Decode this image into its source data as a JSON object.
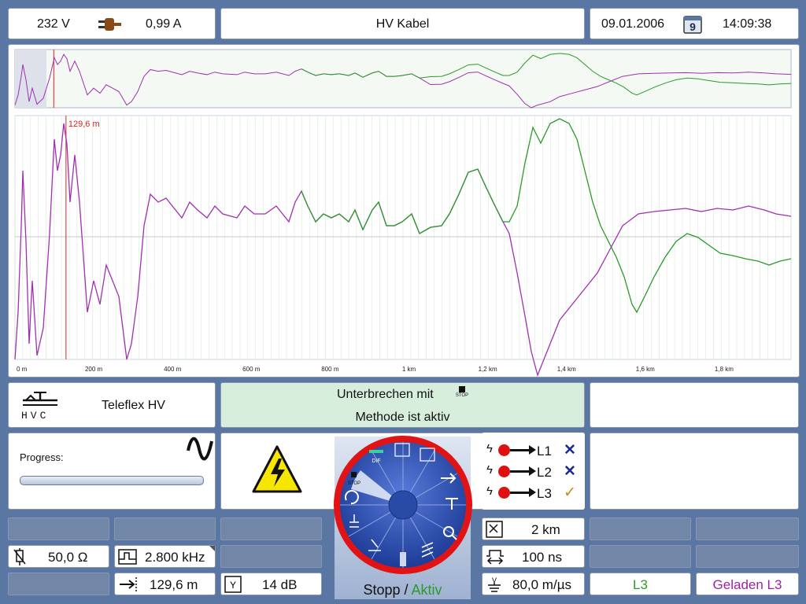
{
  "header": {
    "voltage": "232 V",
    "current": "0,99 A",
    "title": "HV Kabel",
    "date": "09.01.2006",
    "calendar_day": "9",
    "time": "14:09:38"
  },
  "plot": {
    "cursor_label": "129,6 m",
    "x_tick_labels": [
      "0 m",
      "200 m",
      "400 m",
      "600 m",
      "800 m",
      "1 km",
      "1,2 km",
      "1,4 km",
      "1,6 km",
      "1,8 km"
    ],
    "cursor_value_m": 129.6,
    "x_range_m": [
      0,
      1970
    ],
    "colors": {
      "trace_a": "#a030b0",
      "trace_b": "#2a9a2a",
      "cursor": "#e02020",
      "grid": "#dde8dd"
    }
  },
  "device": {
    "name": "Teleflex HV",
    "logo_text": "HVC"
  },
  "message": {
    "line1": "Unterbrechen mit",
    "stop_label": "STOP",
    "line2": "Methode ist aktiv"
  },
  "progress": {
    "label": "Progress:",
    "value": 0
  },
  "dial": {
    "status_stop": "Stopp",
    "status_sep": " / ",
    "status_active": "Aktiv",
    "segment_dif": "DIF",
    "segment_stop": "STOP"
  },
  "lines": [
    {
      "label": "L1",
      "status": "x"
    },
    {
      "label": "L2",
      "status": "x"
    },
    {
      "label": "L3",
      "status": "check"
    }
  ],
  "params": {
    "impedance": "50,0 Ω",
    "frequency": "2.800 kHz",
    "cursor_dist": "129,6 m",
    "gain": "14 dB",
    "range": "2 km",
    "pulse": "100 ns",
    "velocity": "80,0 m/µs"
  },
  "footer": {
    "phase": "L3",
    "charged": "Geladen L3"
  }
}
